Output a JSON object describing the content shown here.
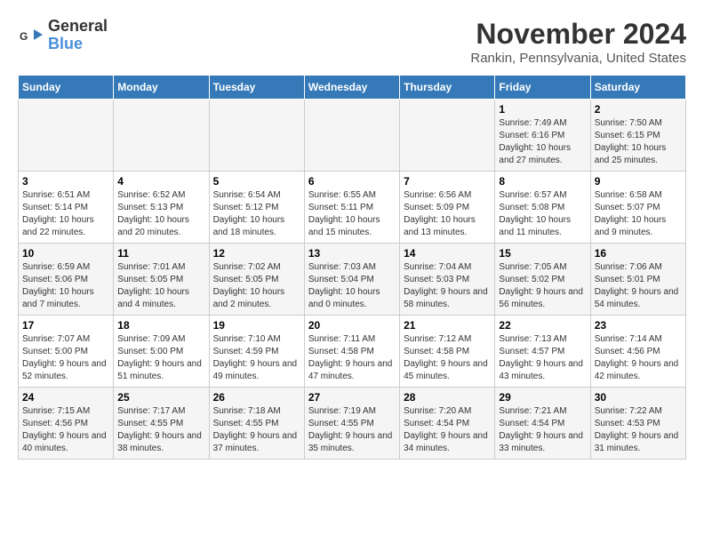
{
  "logo": {
    "general": "General",
    "blue": "Blue"
  },
  "header": {
    "month": "November 2024",
    "location": "Rankin, Pennsylvania, United States"
  },
  "weekdays": [
    "Sunday",
    "Monday",
    "Tuesday",
    "Wednesday",
    "Thursday",
    "Friday",
    "Saturday"
  ],
  "weeks": [
    [
      {
        "day": "",
        "info": ""
      },
      {
        "day": "",
        "info": ""
      },
      {
        "day": "",
        "info": ""
      },
      {
        "day": "",
        "info": ""
      },
      {
        "day": "",
        "info": ""
      },
      {
        "day": "1",
        "info": "Sunrise: 7:49 AM\nSunset: 6:16 PM\nDaylight: 10 hours and 27 minutes."
      },
      {
        "day": "2",
        "info": "Sunrise: 7:50 AM\nSunset: 6:15 PM\nDaylight: 10 hours and 25 minutes."
      }
    ],
    [
      {
        "day": "3",
        "info": "Sunrise: 6:51 AM\nSunset: 5:14 PM\nDaylight: 10 hours and 22 minutes."
      },
      {
        "day": "4",
        "info": "Sunrise: 6:52 AM\nSunset: 5:13 PM\nDaylight: 10 hours and 20 minutes."
      },
      {
        "day": "5",
        "info": "Sunrise: 6:54 AM\nSunset: 5:12 PM\nDaylight: 10 hours and 18 minutes."
      },
      {
        "day": "6",
        "info": "Sunrise: 6:55 AM\nSunset: 5:11 PM\nDaylight: 10 hours and 15 minutes."
      },
      {
        "day": "7",
        "info": "Sunrise: 6:56 AM\nSunset: 5:09 PM\nDaylight: 10 hours and 13 minutes."
      },
      {
        "day": "8",
        "info": "Sunrise: 6:57 AM\nSunset: 5:08 PM\nDaylight: 10 hours and 11 minutes."
      },
      {
        "day": "9",
        "info": "Sunrise: 6:58 AM\nSunset: 5:07 PM\nDaylight: 10 hours and 9 minutes."
      }
    ],
    [
      {
        "day": "10",
        "info": "Sunrise: 6:59 AM\nSunset: 5:06 PM\nDaylight: 10 hours and 7 minutes."
      },
      {
        "day": "11",
        "info": "Sunrise: 7:01 AM\nSunset: 5:05 PM\nDaylight: 10 hours and 4 minutes."
      },
      {
        "day": "12",
        "info": "Sunrise: 7:02 AM\nSunset: 5:05 PM\nDaylight: 10 hours and 2 minutes."
      },
      {
        "day": "13",
        "info": "Sunrise: 7:03 AM\nSunset: 5:04 PM\nDaylight: 10 hours and 0 minutes."
      },
      {
        "day": "14",
        "info": "Sunrise: 7:04 AM\nSunset: 5:03 PM\nDaylight: 9 hours and 58 minutes."
      },
      {
        "day": "15",
        "info": "Sunrise: 7:05 AM\nSunset: 5:02 PM\nDaylight: 9 hours and 56 minutes."
      },
      {
        "day": "16",
        "info": "Sunrise: 7:06 AM\nSunset: 5:01 PM\nDaylight: 9 hours and 54 minutes."
      }
    ],
    [
      {
        "day": "17",
        "info": "Sunrise: 7:07 AM\nSunset: 5:00 PM\nDaylight: 9 hours and 52 minutes."
      },
      {
        "day": "18",
        "info": "Sunrise: 7:09 AM\nSunset: 5:00 PM\nDaylight: 9 hours and 51 minutes."
      },
      {
        "day": "19",
        "info": "Sunrise: 7:10 AM\nSunset: 4:59 PM\nDaylight: 9 hours and 49 minutes."
      },
      {
        "day": "20",
        "info": "Sunrise: 7:11 AM\nSunset: 4:58 PM\nDaylight: 9 hours and 47 minutes."
      },
      {
        "day": "21",
        "info": "Sunrise: 7:12 AM\nSunset: 4:58 PM\nDaylight: 9 hours and 45 minutes."
      },
      {
        "day": "22",
        "info": "Sunrise: 7:13 AM\nSunset: 4:57 PM\nDaylight: 9 hours and 43 minutes."
      },
      {
        "day": "23",
        "info": "Sunrise: 7:14 AM\nSunset: 4:56 PM\nDaylight: 9 hours and 42 minutes."
      }
    ],
    [
      {
        "day": "24",
        "info": "Sunrise: 7:15 AM\nSunset: 4:56 PM\nDaylight: 9 hours and 40 minutes."
      },
      {
        "day": "25",
        "info": "Sunrise: 7:17 AM\nSunset: 4:55 PM\nDaylight: 9 hours and 38 minutes."
      },
      {
        "day": "26",
        "info": "Sunrise: 7:18 AM\nSunset: 4:55 PM\nDaylight: 9 hours and 37 minutes."
      },
      {
        "day": "27",
        "info": "Sunrise: 7:19 AM\nSunset: 4:55 PM\nDaylight: 9 hours and 35 minutes."
      },
      {
        "day": "28",
        "info": "Sunrise: 7:20 AM\nSunset: 4:54 PM\nDaylight: 9 hours and 34 minutes."
      },
      {
        "day": "29",
        "info": "Sunrise: 7:21 AM\nSunset: 4:54 PM\nDaylight: 9 hours and 33 minutes."
      },
      {
        "day": "30",
        "info": "Sunrise: 7:22 AM\nSunset: 4:53 PM\nDaylight: 9 hours and 31 minutes."
      }
    ]
  ]
}
